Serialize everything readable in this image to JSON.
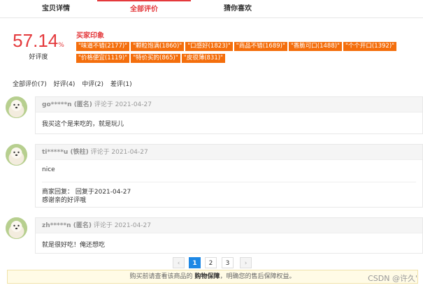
{
  "tabs": [
    "宝贝详情",
    "全部评价",
    "猜你喜欢"
  ],
  "score": {
    "value": "57.14",
    "unit": "%",
    "label": "好评度"
  },
  "impressions": {
    "title": "买家印象",
    "tags": [
      "\"味道不错(2177)\"",
      "\"颗粒饱满(1860)\"",
      "\"口感好(1823)\"",
      "\"商品不错(1689)\"",
      "\"香脆可口(1488)\"",
      "\"个个开口(1392)\"",
      "\"价格便宜(1119)\"",
      "\"特价买的(865)\"",
      "\"皮很薄(831)\""
    ]
  },
  "filters": [
    "全部评价(7)",
    "好评(4)",
    "中评(2)",
    "差评(1)"
  ],
  "comments": [
    {
      "user": "go*****n (匿名)",
      "meta": "评论于 2021-04-27",
      "text": "我买这个是来吃的，就是玩儿"
    },
    {
      "user": "ti*****u (铁柱)",
      "meta": "评论于 2021-04-27",
      "text": "nice",
      "reply_head": "商家回复： 回复于2021-04-27",
      "reply_text": "感谢亲的好评哦"
    },
    {
      "user": "zh*****n (匿名)",
      "meta": "评论于 2021-04-27",
      "text": "就是很好吃！俺还想吃"
    }
  ],
  "pager": {
    "prev": "‹",
    "pages": [
      "1",
      "2",
      "3"
    ],
    "next": "›"
  },
  "notice": {
    "before": "购买前请查看该商品的 ",
    "link": "购物保障",
    "after": "，明确您的售后保障权益。"
  },
  "watermark": "CSDN @许久'"
}
